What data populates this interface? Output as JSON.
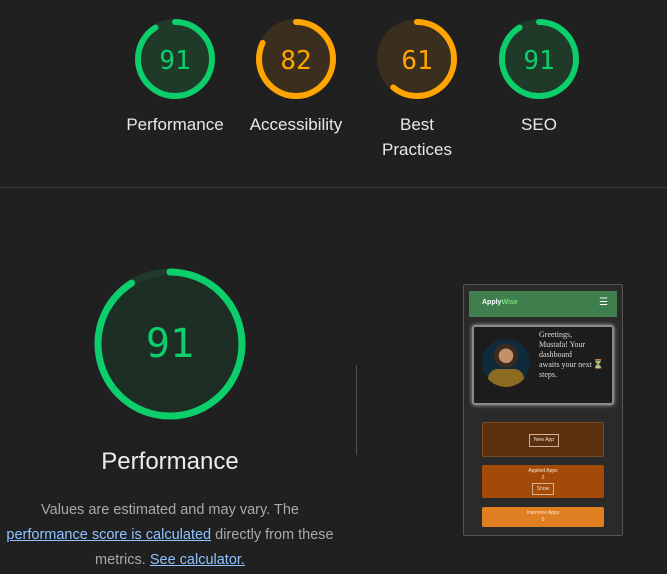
{
  "scores": [
    {
      "id": "performance",
      "value": "91",
      "fraction": 0.91,
      "label": "Performance",
      "color": "#0cce6b",
      "track": "#1f3a28"
    },
    {
      "id": "accessibility",
      "value": "82",
      "fraction": 0.82,
      "label": "Accessibility",
      "color": "#ffa400",
      "track": "#3a2f1e"
    },
    {
      "id": "best-practices",
      "value": "61",
      "fraction": 0.61,
      "label": "Best Practices",
      "color": "#ffa400",
      "track": "#3a2f1e"
    },
    {
      "id": "seo",
      "value": "91",
      "fraction": 0.91,
      "label": "SEO",
      "color": "#0cce6b",
      "track": "#1f3a28"
    }
  ],
  "main": {
    "score": "91",
    "fraction": 0.91,
    "title": "Performance",
    "desc_prefix": "Values are estimated and may vary. The ",
    "desc_link": "performance score is calculated",
    "desc_middle": " directly from these metrics. ",
    "desc_link2": "See calculator."
  },
  "phone": {
    "logo_a": "Apply",
    "logo_b": "Wise",
    "menu_icon": "hamburger-icon",
    "greeting": "Greetings, Mustafa! Your dashboard awaits your next steps.",
    "hourglass_icon": "hourglass-icon",
    "new_app_button": "New App",
    "applied_title": "Applied Apps",
    "applied_count": "2",
    "show_button": "Show",
    "interview_title": "Interview Apps",
    "interview_count": "0"
  }
}
